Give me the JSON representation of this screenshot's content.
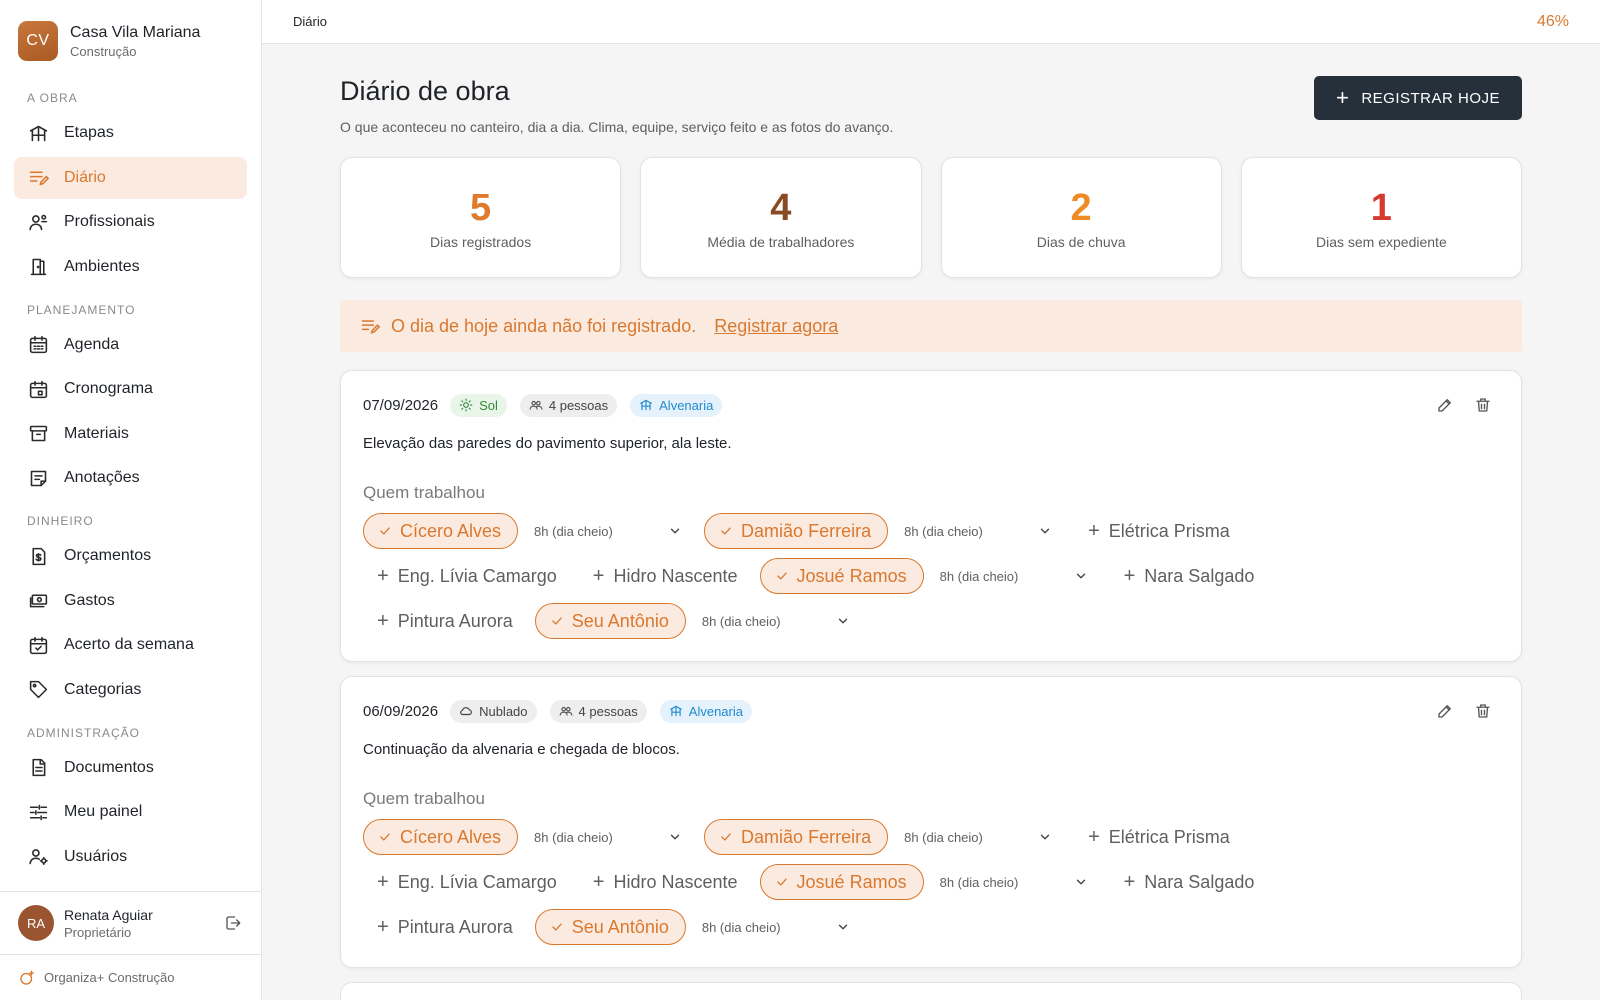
{
  "brand": {
    "initials": "CV",
    "name": "Casa Vila Mariana",
    "subtitle": "Construção"
  },
  "sidebar": {
    "sections": [
      {
        "title": "A OBRA",
        "items": [
          {
            "label": "Etapas",
            "icon": "stages-icon"
          },
          {
            "label": "Diário",
            "icon": "journal-icon",
            "active": true
          },
          {
            "label": "Profissionais",
            "icon": "professionals-icon"
          },
          {
            "label": "Ambientes",
            "icon": "door-icon"
          }
        ]
      },
      {
        "title": "PLANEJAMENTO",
        "items": [
          {
            "label": "Agenda",
            "icon": "calendar-grid-icon"
          },
          {
            "label": "Cronograma",
            "icon": "calendar-event-icon"
          },
          {
            "label": "Materiais",
            "icon": "archive-box-icon"
          },
          {
            "label": "Anotações",
            "icon": "note-icon"
          }
        ]
      },
      {
        "title": "DINHEIRO",
        "items": [
          {
            "label": "Orçamentos",
            "icon": "invoice-icon"
          },
          {
            "label": "Gastos",
            "icon": "money-icon"
          },
          {
            "label": "Acerto da semana",
            "icon": "calendar-check-icon"
          },
          {
            "label": "Categorias",
            "icon": "tag-icon"
          }
        ]
      },
      {
        "title": "ADMINISTRAÇÃO",
        "items": [
          {
            "label": "Documentos",
            "icon": "document-icon"
          },
          {
            "label": "Meu painel",
            "icon": "sliders-icon"
          },
          {
            "label": "Usuários",
            "icon": "user-settings-icon"
          }
        ]
      }
    ]
  },
  "user": {
    "initials": "RA",
    "name": "Renata Aguiar",
    "role": "Proprietário"
  },
  "product": {
    "name": "Organiza+ Construção"
  },
  "topbar": {
    "breadcrumb": "Diário",
    "progress": "46%"
  },
  "page": {
    "title": "Diário de obra",
    "subtitle": "O que aconteceu no canteiro, dia a dia. Clima, equipe, serviço feito e as fotos do avanço.",
    "primary_button": "REGISTRAR HOJE"
  },
  "stats": [
    {
      "value": "5",
      "label": "Dias registrados",
      "color": "#e07a2e"
    },
    {
      "value": "4",
      "label": "Média de trabalhadores",
      "color": "#8a4b22"
    },
    {
      "value": "2",
      "label": "Dias de chuva",
      "color": "#f08a24"
    },
    {
      "value": "1",
      "label": "Dias sem expediente",
      "color": "#d63a2f"
    }
  ],
  "banner": {
    "text": "O dia de hoje ainda não foi registrado.",
    "link": "Registrar agora"
  },
  "worked_label": "Quem trabalhou",
  "entries": [
    {
      "date": "07/09/2026",
      "weather": "Sol",
      "weather_icon": "sun-icon",
      "people": "4 pessoas",
      "stage": "Alvenaria",
      "description": "Elevação das paredes do pavimento superior, ala leste.",
      "workers": [
        {
          "name": "Cícero Alves",
          "selected": true,
          "hours": "8h (dia cheio)"
        },
        {
          "name": "Damião Ferreira",
          "selected": true,
          "hours": "8h (dia cheio)"
        },
        {
          "name": "Elétrica Prisma",
          "selected": false
        },
        {
          "name": "Eng. Lívia Camargo",
          "selected": false
        },
        {
          "name": "Hidro Nascente",
          "selected": false
        },
        {
          "name": "Josué Ramos",
          "selected": true,
          "hours": "8h (dia cheio)"
        },
        {
          "name": "Nara Salgado",
          "selected": false
        },
        {
          "name": "Pintura Aurora",
          "selected": false
        },
        {
          "name": "Seu Antônio",
          "selected": true,
          "hours": "8h (dia cheio)"
        }
      ]
    },
    {
      "date": "06/09/2026",
      "weather": "Nublado",
      "weather_icon": "cloud-icon",
      "people": "4 pessoas",
      "stage": "Alvenaria",
      "description": "Continuação da alvenaria e chegada de blocos.",
      "workers": [
        {
          "name": "Cícero Alves",
          "selected": true,
          "hours": "8h (dia cheio)"
        },
        {
          "name": "Damião Ferreira",
          "selected": true,
          "hours": "8h (dia cheio)"
        },
        {
          "name": "Elétrica Prisma",
          "selected": false
        },
        {
          "name": "Eng. Lívia Camargo",
          "selected": false
        },
        {
          "name": "Hidro Nascente",
          "selected": false
        },
        {
          "name": "Josué Ramos",
          "selected": true,
          "hours": "8h (dia cheio)"
        },
        {
          "name": "Nara Salgado",
          "selected": false
        },
        {
          "name": "Pintura Aurora",
          "selected": false
        },
        {
          "name": "Seu Antônio",
          "selected": true,
          "hours": "8h (dia cheio)"
        }
      ]
    }
  ]
}
